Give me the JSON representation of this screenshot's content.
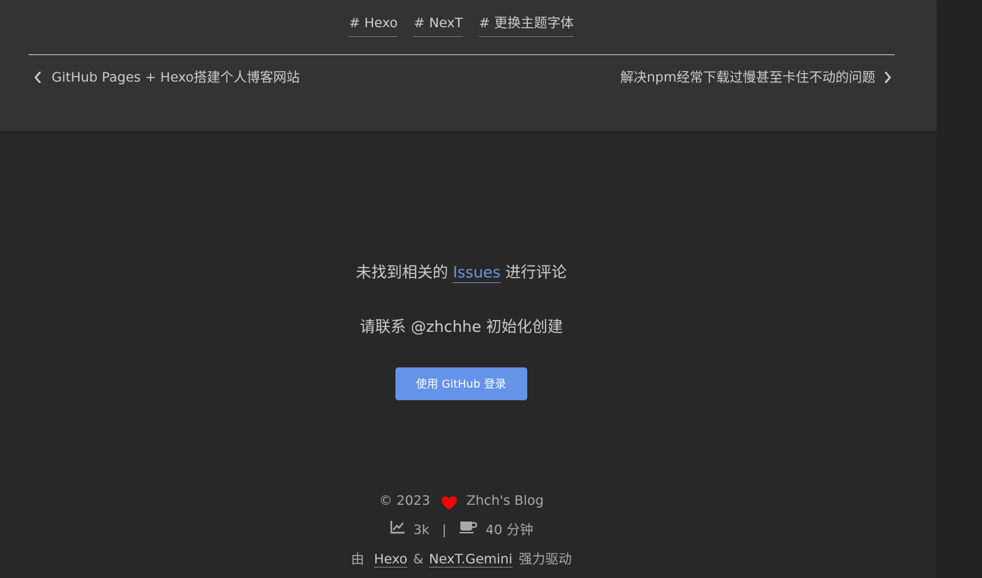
{
  "post": {
    "tags": [
      "# Hexo",
      "# NexT",
      "# 更换主题字体"
    ],
    "prev_title": "GitHub Pages + Hexo搭建个人博客网站",
    "next_title": "解决npm经常下载过慢甚至卡住不动的问题"
  },
  "comments": {
    "line1_before": "未找到相关的 ",
    "issues_link": "Issues",
    "line1_after": " 进行评论",
    "line2": "请联系 @zhchhe 初始化创建",
    "login_button": "使用 GitHub 登录"
  },
  "footer": {
    "copyright": "© 2023",
    "site_name": "Zhch's Blog",
    "word_count": "3k",
    "separator": "|",
    "read_time": "40 分钟",
    "powered_prefix": "由",
    "hexo_link": "Hexo",
    "amp": "&",
    "theme_link": "NexT.Gemini",
    "powered_suffix": "强力驱动"
  },
  "colors": {
    "background": "#282828",
    "card": "#333333",
    "accent": "#6493e8",
    "heart": "#ff0000"
  },
  "icons": [
    "chevron-left-icon",
    "chevron-right-icon",
    "heart-icon",
    "chart-line-icon",
    "coffee-icon"
  ]
}
